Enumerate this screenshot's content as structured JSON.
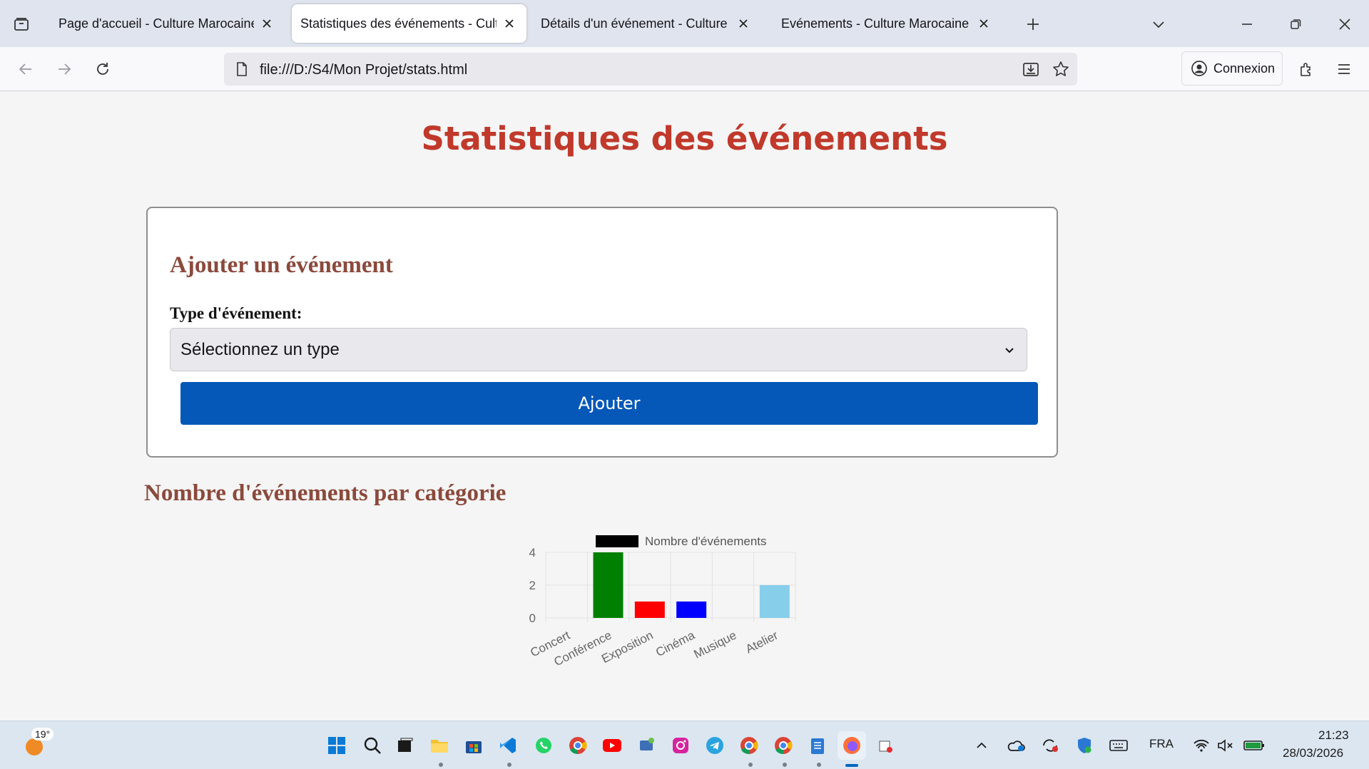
{
  "browser": {
    "tabs": [
      {
        "title": "Page d'accueil - Culture Marocaine",
        "active": false
      },
      {
        "title": "Statistiques des événements - Culture Marocaine",
        "active": true
      },
      {
        "title": "Détails d'un événement - Culture Marocaine",
        "active": false
      },
      {
        "title": "Evénements - Culture Marocaine",
        "active": false
      }
    ],
    "url": "file:///D:/S4/Mon Projet/stats.html",
    "signin_label": "Connexion"
  },
  "page": {
    "title": "Statistiques des événements",
    "form": {
      "heading": "Ajouter un événement",
      "type_label": "Type d'événement:",
      "select_value": "Sélectionnez un type",
      "submit_label": "Ajouter"
    },
    "chart_section_title": "Nombre d'événements par catégorie"
  },
  "chart_data": {
    "type": "bar",
    "categories": [
      "Concert",
      "Conférence",
      "Exposition",
      "Cinéma",
      "Musique",
      "Atelier"
    ],
    "series": [
      {
        "name": "Nombre d'événements",
        "values": [
          0,
          4,
          1,
          1,
          0,
          2
        ]
      }
    ],
    "bar_colors": [
      "#000000",
      "#008000",
      "#ff0000",
      "#0000ff",
      "#800080",
      "#87ceeb"
    ],
    "legend_color": "#000000",
    "y_ticks": [
      0,
      2,
      4
    ],
    "ylim": [
      0,
      4
    ],
    "grid": true,
    "legend_position": "top"
  },
  "taskbar": {
    "weather_temp": "19°",
    "language": "FRA",
    "time": "21:23",
    "date": "28/03/2026",
    "apps": [
      "start-icon",
      "search-icon",
      "task-view-icon",
      "file-explorer-icon",
      "store-icon",
      "vscode-icon",
      "whatsapp-icon",
      "chrome-icon",
      "youtube-icon",
      "network-app-icon",
      "instagram-icon",
      "telegram-icon",
      "chrome-profile-icon",
      "chrome-dev-icon",
      "notepad-icon",
      "firefox-icon",
      "paint-icon"
    ]
  }
}
